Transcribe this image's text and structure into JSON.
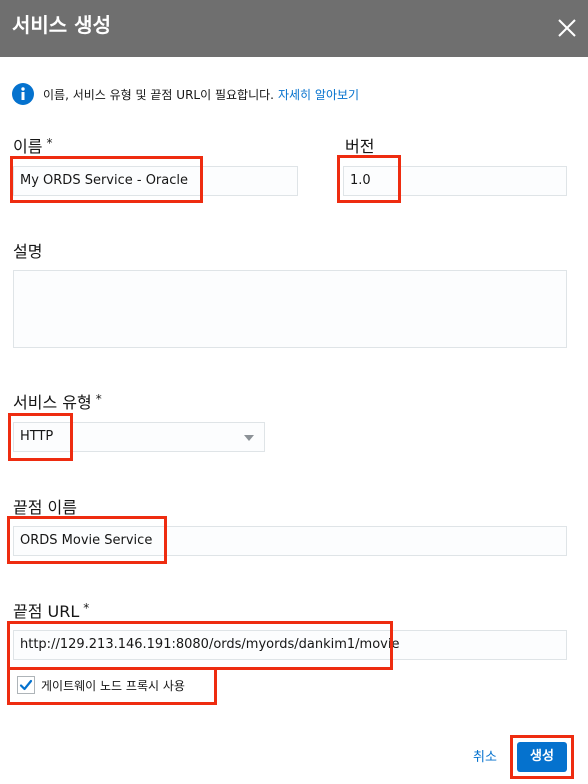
{
  "header": {
    "title": "서비스 생성"
  },
  "info": {
    "text": "이름, 서비스 유형 및 끝점 URL이 필요합니다.",
    "link": "자세히 알아보기"
  },
  "fields": {
    "name_label": "이름",
    "name_value": "My ORDS Service - Oracle",
    "version_label": "버전",
    "version_value": "1.0",
    "description_label": "설명",
    "service_type_label": "서비스 유형",
    "service_type_value": "HTTP",
    "endpoint_name_label": "끝점 이름",
    "endpoint_name_value": "ORDS Movie Service",
    "endpoint_url_label": "끝점 URL",
    "endpoint_url_value": "http://129.213.146.191:8080/ords/myords/dankim1/movie",
    "required_mark": "*"
  },
  "checkbox": {
    "label": "게이트웨이 노드 프록시 사용",
    "checked": true
  },
  "footer": {
    "cancel_label": "취소",
    "create_label": "생성"
  },
  "colors": {
    "header_bg": "#6f6f6f",
    "accent": "#0572ce",
    "highlight": "#ee2c10"
  }
}
